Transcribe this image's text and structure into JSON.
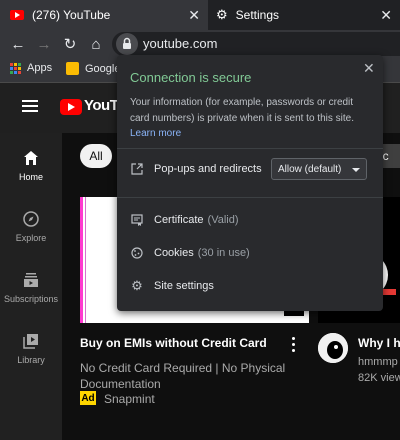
{
  "browser": {
    "tabs": [
      {
        "label": "(276) YouTube",
        "active": true
      },
      {
        "label": "Settings",
        "active": false
      }
    ],
    "url": "youtube.com",
    "bookmarks": [
      {
        "label": "Apps"
      },
      {
        "label": "Google"
      }
    ]
  },
  "youtube": {
    "logo_text": "YouTub",
    "sidebar": [
      {
        "label": "Home",
        "icon": "home-icon"
      },
      {
        "label": "Explore",
        "icon": "compass-icon"
      },
      {
        "label": "Subscriptions",
        "icon": "subscriptions-icon"
      },
      {
        "label": "Library",
        "icon": "library-icon"
      }
    ],
    "chips": {
      "all": "All",
      "right": "rac"
    },
    "video1": {
      "title": "Buy on EMIs without Credit Card",
      "desc": "No Credit Card Required | No Physical Documentation",
      "ad_badge": "Ad",
      "advertiser": "Snapmint"
    },
    "video2": {
      "title": "Why I ha",
      "channel": "hmmmp",
      "views": "82K view"
    }
  },
  "site_info": {
    "title": "Connection is secure",
    "body": "Your information (for example, passwords or credit card numbers) is private when it is sent to this site.",
    "learn_more": "Learn more",
    "popups_label": "Pop-ups and redirects",
    "popups_value": "Allow (default)",
    "certificate_label": "Certificate",
    "certificate_status": "(Valid)",
    "cookies_label": "Cookies",
    "cookies_count": "(30 in use)",
    "site_settings_label": "Site settings"
  },
  "colors": {
    "accent_green": "#81c995",
    "link_blue": "#8ab4f8",
    "yt_red": "#ff0000",
    "ad_yellow": "#ffd600"
  }
}
